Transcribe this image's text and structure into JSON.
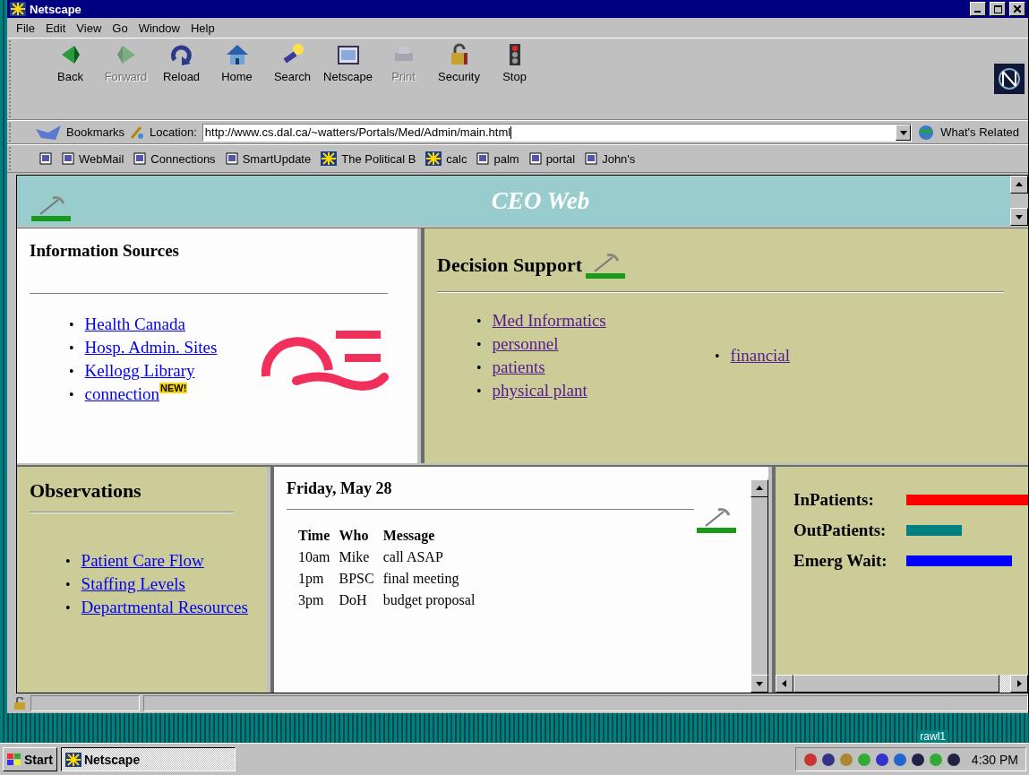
{
  "window": {
    "title": "Netscape"
  },
  "menu": [
    "File",
    "Edit",
    "View",
    "Go",
    "Window",
    "Help"
  ],
  "toolbar": [
    {
      "kind": "back",
      "label": "Back",
      "disabled": false
    },
    {
      "kind": "forward",
      "label": "Forward",
      "disabled": true
    },
    {
      "kind": "reload",
      "label": "Reload",
      "disabled": false
    },
    {
      "kind": "home",
      "label": "Home",
      "disabled": false
    },
    {
      "kind": "search",
      "label": "Search",
      "disabled": false
    },
    {
      "kind": "netscape",
      "label": "Netscape",
      "disabled": false
    },
    {
      "kind": "print",
      "label": "Print",
      "disabled": true
    },
    {
      "kind": "security",
      "label": "Security",
      "disabled": false
    },
    {
      "kind": "stop",
      "label": "Stop",
      "disabled": false
    }
  ],
  "location_bar": {
    "bookmarks": "Bookmarks",
    "label": "Location:",
    "url": "http://www.cs.dal.ca/~watters/Portals/Med/Admin/main.html",
    "related": "What's Related"
  },
  "personal_toolbar": [
    {
      "kind": "page"
    },
    {
      "kind": "page",
      "label": "WebMail"
    },
    {
      "kind": "page",
      "label": "Connections"
    },
    {
      "kind": "page",
      "label": "SmartUpdate"
    },
    {
      "kind": "star",
      "label": "The Political B"
    },
    {
      "kind": "star",
      "label": "calc"
    },
    {
      "kind": "page",
      "label": "palm"
    },
    {
      "kind": "page",
      "label": "portal"
    },
    {
      "kind": "page",
      "label": "John's"
    }
  ],
  "banner": {
    "title": "CEO Web"
  },
  "information_sources": {
    "heading": "Information Sources",
    "bullet": "•",
    "links": [
      {
        "label": "Health Canada"
      },
      {
        "label": "Hosp. Admin. Sites"
      },
      {
        "label": "Kellogg Library"
      },
      {
        "label": "connection",
        "badge": "NEW!"
      }
    ]
  },
  "decision_support": {
    "heading": "Decision Support",
    "bullet": "•",
    "links": [
      "Med Informatics",
      "personnel",
      "patients",
      "physical plant"
    ],
    "side_links": [
      "financial"
    ]
  },
  "observations": {
    "heading": "Observations",
    "bullet": "•",
    "links": [
      "Patient Care Flow",
      "Staffing Levels",
      "Departmental Resources"
    ]
  },
  "calendar": {
    "date": "Friday, May 28",
    "columns": [
      "Time",
      "Who",
      "Message"
    ],
    "rows": [
      [
        "10am",
        "Mike",
        "call ASAP"
      ],
      [
        "1pm",
        "BPSC",
        "final meeting"
      ],
      [
        "3pm",
        "DoH",
        "budget proposal"
      ]
    ]
  },
  "indicators": [
    {
      "label": "InPatients:",
      "color": "#ff0000"
    },
    {
      "label": "OutPatients:",
      "color": "#008080"
    },
    {
      "label": "Emerg Wait:",
      "color": "#0000ff"
    }
  ],
  "desktop": {
    "label": "rawl1"
  },
  "taskbar": {
    "start": "Start",
    "task": "Netscape",
    "time": "4:30 PM"
  }
}
